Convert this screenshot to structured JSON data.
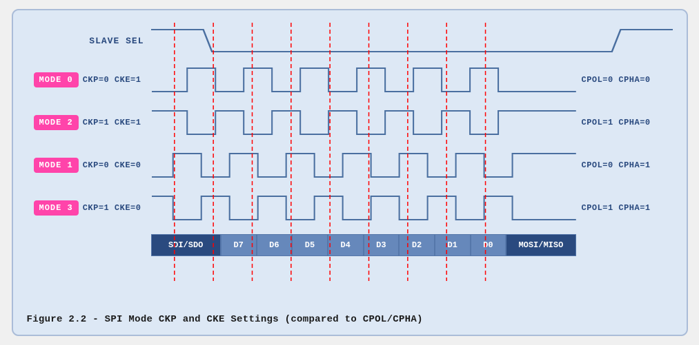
{
  "diagram": {
    "title": "Figure 2.2 - SPI Mode CKP and CKE Settings (compared to CPOL/CPHA)",
    "slave_sel_label": "SLAVE SEL",
    "modes": [
      {
        "badge": "MODE 0",
        "params": "CKP=0  CKE=1",
        "cpol": "CPOL=0  CPHA=0",
        "wave_type": "low_start"
      },
      {
        "badge": "MODE 2",
        "params": "CKP=1  CKE=1",
        "cpol": "CPOL=1  CPHA=0",
        "wave_type": "high_start"
      },
      {
        "badge": "MODE 1",
        "params": "CKP=0  CKE=0",
        "cpol": "CPOL=0  CPHA=1",
        "wave_type": "low_start_shifted"
      },
      {
        "badge": "MODE 3",
        "params": "CKP=1  CKE=0",
        "cpol": "CPOL=1  CPHA=1",
        "wave_type": "high_start_shifted"
      }
    ],
    "data_segments": [
      {
        "label": "SDI/SDO",
        "type": "dark",
        "flex": 2
      },
      {
        "label": "D7",
        "type": "light",
        "flex": 1
      },
      {
        "label": "D6",
        "type": "light",
        "flex": 1
      },
      {
        "label": "D5",
        "type": "light",
        "flex": 1
      },
      {
        "label": "D4",
        "type": "light",
        "flex": 1
      },
      {
        "label": "D3",
        "type": "light",
        "flex": 1
      },
      {
        "label": "D2",
        "type": "light",
        "flex": 1
      },
      {
        "label": "D1",
        "type": "light",
        "flex": 1
      },
      {
        "label": "D0",
        "type": "light",
        "flex": 1
      },
      {
        "label": "MOSI/MISO",
        "type": "dark",
        "flex": 2
      }
    ],
    "dashed_lines": [
      0.14,
      0.21,
      0.28,
      0.35,
      0.42,
      0.49,
      0.57,
      0.64,
      0.71
    ]
  }
}
